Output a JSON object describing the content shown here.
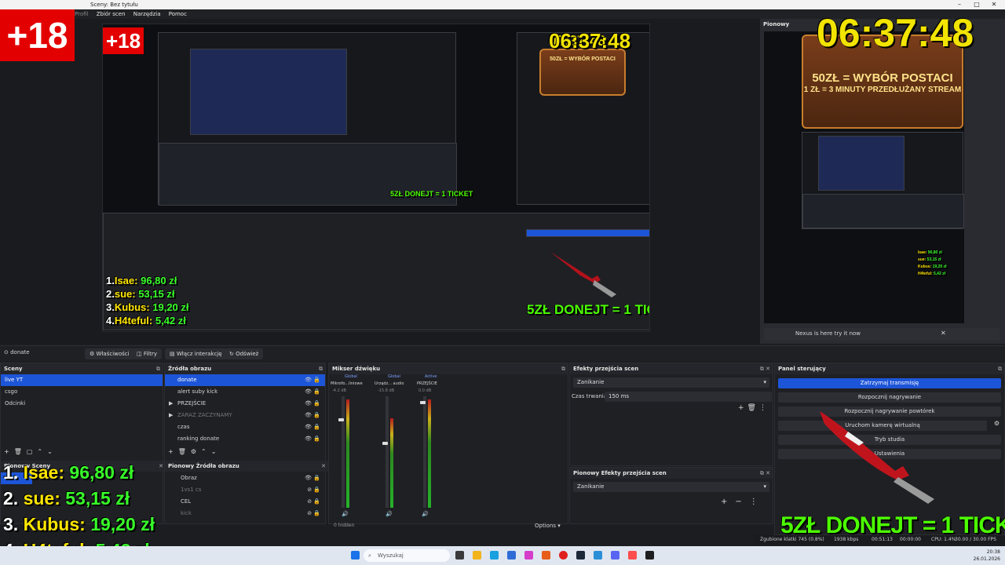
{
  "window": {
    "title": "Sceny: Bez tytułu",
    "menu": [
      "Profil",
      "Zbiór scen",
      "Narzędzia",
      "Pomoc"
    ]
  },
  "overlay": {
    "age_badge": "+18",
    "clock": "06:37:48",
    "donate_ticket": "5ZŁ DONEJT = 1 TICKET",
    "banner_line1": "50ZŁ = WYBÓR POSTACI",
    "banner_line2": "1 ZŁ = 3 MINUTY PRZEDŁUŻANY STREAM",
    "ranking": [
      {
        "n": "1.",
        "name": "Isae:",
        "value": "96,80 zł"
      },
      {
        "n": "2.",
        "name": "sue:",
        "value": "53,15 zł"
      },
      {
        "n": "3.",
        "name": "Kubus:",
        "value": "19,20 zł"
      },
      {
        "n": "4.",
        "name": "H4teful:",
        "value": "5,42 zł"
      }
    ]
  },
  "vertical": {
    "title": "Pionowy",
    "nexus": "Nexus is here try it now"
  },
  "toolbar": {
    "source": "donate",
    "properties": "Właściwości",
    "filters": "Filtry",
    "interact": "Włącz interakcję",
    "refresh": "Odśwież"
  },
  "scenes": {
    "title": "Sceny",
    "items": [
      "live YT",
      "csgo",
      "Odcinki"
    ]
  },
  "sources": {
    "title": "Źródła obrazu",
    "items": [
      "donate",
      "alert suby kick",
      "PRZEJŚCIE",
      "ZARAZ ZACZYNAMY",
      "czas",
      "ranking donate"
    ]
  },
  "v_scenes": {
    "title": "Pionowy Sceny",
    "item": "tiktok"
  },
  "v_sources": {
    "title": "Pionowy Źródła obrazu",
    "items": [
      "Obraz",
      "1vs1 cs",
      "CEL",
      "kick"
    ]
  },
  "mixer": {
    "title": "Mikser dźwięku",
    "channels": [
      {
        "tag": "Global",
        "name": "Mikrofo...liniowe",
        "db": "-4.2 dB"
      },
      {
        "tag": "Global",
        "name": "Urządz... audio",
        "db": "-15.8 dB"
      },
      {
        "tag": "Active",
        "name": "PRZEJŚCIE",
        "db": "0.0 dB"
      }
    ],
    "hidden": "0 hidden",
    "options": "Options"
  },
  "transitions": {
    "title": "Efekty przejścia scen",
    "value": "Zanikanie",
    "duration_label": "Czas trwania",
    "duration": "150 ms"
  },
  "v_transitions": {
    "title": "Pionowy Efekty przejścia scen",
    "value": "Zanikanie"
  },
  "controls": {
    "title": "Panel sterujący",
    "buttons": [
      "Zatrzymaj transmisję",
      "Rozpocznij nagrywanie",
      "Rozpocznij nagrywanie powtórek",
      "Uruchom kamerę wirtualną",
      "Tryb studia",
      "Ustawienia"
    ]
  },
  "status": {
    "dropped": "Zgubione klatki 745 (0.8%)",
    "kbps": "1938 kbps",
    "time": "00:51:13",
    "rec": "00:00:00",
    "cpu": "CPU: 1.4%",
    "fps": "30.00 / 30.00 FPS"
  },
  "taskbar": {
    "search": "Wyszukaj",
    "clock_time": "20:38",
    "clock_date": "26.01.2026"
  },
  "colors": {
    "accent": "#1d55d8",
    "ticket": "#4cff00",
    "clock": "#f2e400",
    "badge": "#e30000"
  }
}
